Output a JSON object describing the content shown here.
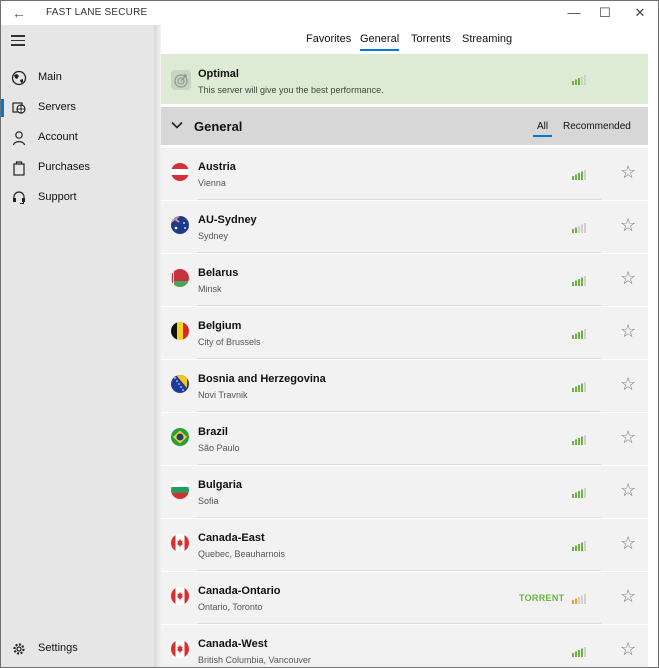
{
  "app": {
    "title": "FAST LANE SECURE"
  },
  "window_controls": {
    "minimize": "—",
    "maximize": "☐",
    "close": "✕"
  },
  "sidebar": {
    "items": [
      {
        "label": "Main",
        "icon": "globe-icon"
      },
      {
        "label": "Servers",
        "icon": "servers-icon",
        "active": true
      },
      {
        "label": "Account",
        "icon": "person-icon"
      },
      {
        "label": "Purchases",
        "icon": "bag-icon"
      },
      {
        "label": "Support",
        "icon": "headset-icon"
      }
    ],
    "settings_label": "Settings"
  },
  "tabs": [
    {
      "label": "Favorites"
    },
    {
      "label": "General",
      "active": true
    },
    {
      "label": "Torrents"
    },
    {
      "label": "Streaming"
    }
  ],
  "optimal": {
    "title": "Optimal",
    "subtitle": "This server will give you the best performance."
  },
  "section": {
    "title": "General",
    "filters": {
      "all": "All",
      "recommended": "Recommended"
    }
  },
  "servers": [
    {
      "country": "Austria",
      "city": "Vienna",
      "flag": "austria",
      "signal_bars": 4
    },
    {
      "country": "AU-Sydney",
      "city": "Sydney",
      "flag": "australia",
      "signal_bars": 2
    },
    {
      "country": "Belarus",
      "city": "Minsk",
      "flag": "belarus",
      "signal_bars": 4
    },
    {
      "country": "Belgium",
      "city": "City of Brussels",
      "flag": "belgium",
      "signal_bars": 4
    },
    {
      "country": "Bosnia and Herzegovina",
      "city": "Novi Travnik",
      "flag": "bosnia",
      "signal_bars": 4
    },
    {
      "country": "Brazil",
      "city": "São Paulo",
      "flag": "brazil",
      "signal_bars": 4
    },
    {
      "country": "Bulgaria",
      "city": "Sofia",
      "flag": "bulgaria",
      "signal_bars": 4
    },
    {
      "country": "Canada-East",
      "city": "Quebec, Beauharnois",
      "flag": "canada",
      "signal_bars": 4
    },
    {
      "country": "Canada-Ontario",
      "city": "Ontario, Toronto",
      "flag": "canada",
      "signal_bars": 2,
      "badge": "TORRENT",
      "signal_color": "#f0a020"
    },
    {
      "country": "Canada-West",
      "city": "British Columbia, Vancouver",
      "flag": "canada",
      "signal_bars": 4
    }
  ],
  "colors": {
    "accent": "#0078d7",
    "signal_green": "#6db33f",
    "torrent_green": "#6db33f",
    "signal_orange": "#f0a020"
  }
}
